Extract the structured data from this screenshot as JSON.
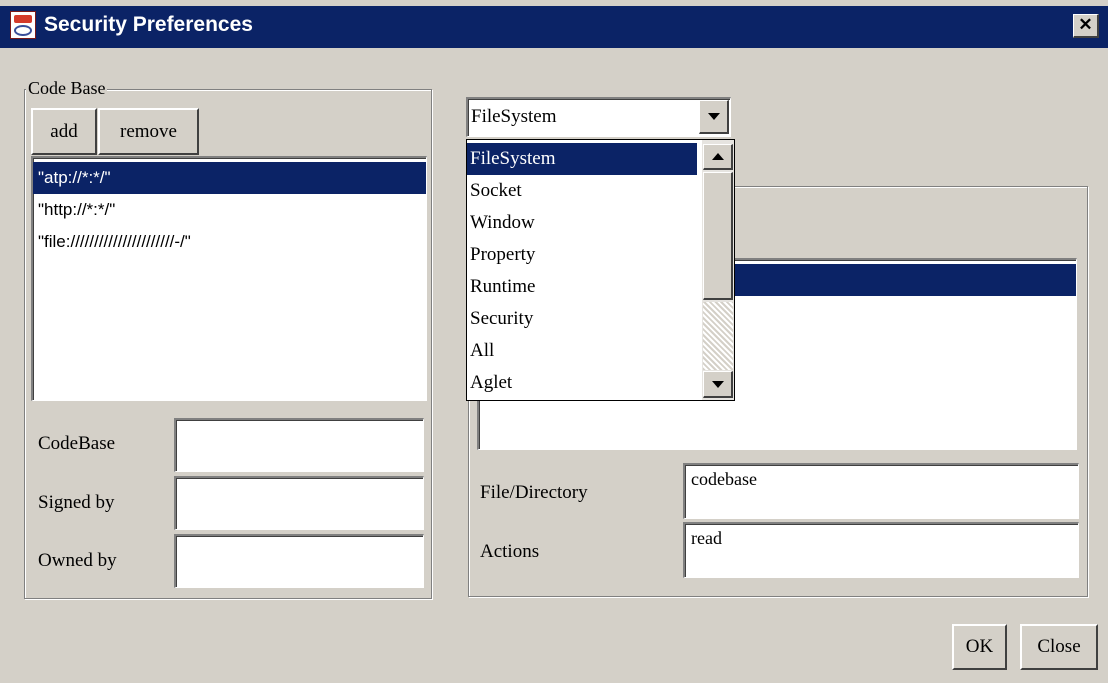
{
  "window": {
    "title": "Security Preferences",
    "close_glyph": "✕",
    "app_icon": "java-app-icon"
  },
  "code_base": {
    "legend": "Code Base",
    "add_label": "add",
    "remove_label": "remove",
    "entries": [
      "\"atp://*:*/\"",
      "\"http://*:*/\"",
      "\"file://////////////////////-/\""
    ],
    "selected_index": 0,
    "codebase_label": "CodeBase",
    "signed_by_label": "Signed by",
    "owned_by_label": "Owned by",
    "codebase_value": "",
    "signed_by_value": "",
    "owned_by_value": ""
  },
  "permission": {
    "selected": "FileSystem",
    "options": [
      "FileSystem",
      "Socket",
      "Window",
      "Property",
      "Runtime",
      "Security",
      "All",
      "Aglet"
    ],
    "highlighted_index": 0,
    "file_directory_label": "File/Directory",
    "actions_label": "Actions",
    "file_directory_value": "codebase",
    "actions_value": "read"
  },
  "footer": {
    "ok_label": "OK",
    "close_label": "Close"
  },
  "colors": {
    "titlebar": "#0b2366",
    "window_bg": "#d4d0c8",
    "selection": "#0b2366"
  }
}
